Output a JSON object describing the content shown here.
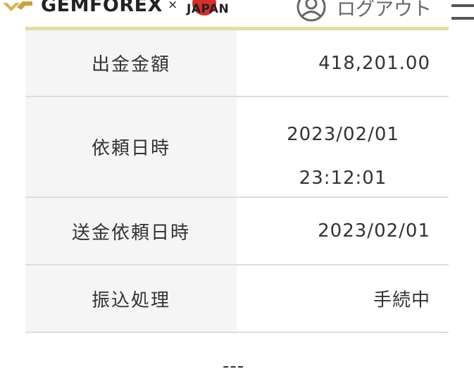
{
  "header": {
    "brand": "GEMFOREX",
    "times_sign": "×",
    "partner": "JAPAN",
    "logout_label": "ログアウト",
    "accent_color": "#e6dca3",
    "icons": [
      "gemforex-logo-icon",
      "user-circle-icon",
      "hamburger-menu-icon"
    ]
  },
  "details": {
    "rows": [
      {
        "label": "出金金額",
        "value": "418,201.00"
      },
      {
        "label": "依頼日時",
        "value": "2023/02/01 23:12:01"
      },
      {
        "label": "送金依頼日時",
        "value": "2023/02/01"
      },
      {
        "label": "振込処理",
        "value": "手続中"
      }
    ]
  },
  "footer": {
    "placeholder": "---"
  }
}
